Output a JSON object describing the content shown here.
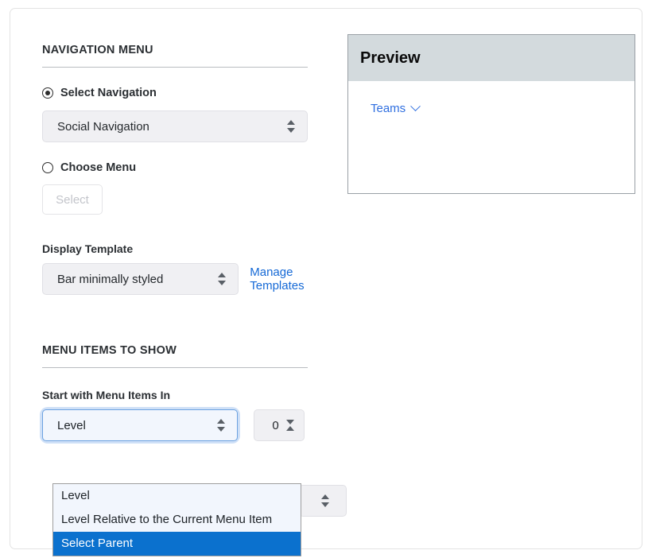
{
  "card": {
    "sections": {
      "navigation": {
        "heading": "NAVIGATION MENU",
        "radio_select_navigation": {
          "label": "Select Navigation",
          "checked": true
        },
        "navigation_select": {
          "value": "Social Navigation"
        },
        "radio_choose_menu": {
          "label": "Choose Menu",
          "checked": false
        },
        "select_button": {
          "label": "Select",
          "disabled": true
        },
        "display_template": {
          "label": "Display Template",
          "value": "Bar minimally styled"
        },
        "manage_templates_link": "Manage Templates"
      },
      "menu_items": {
        "heading": "MENU ITEMS TO SHOW",
        "start_with_label": "Start with Menu Items In",
        "start_with_select": {
          "value": "Level",
          "expanded": true,
          "options": [
            {
              "label": "Level",
              "selected": false
            },
            {
              "label": "Level Relative to the Current Menu Item",
              "selected": false
            },
            {
              "label": "Select Parent",
              "selected": true
            }
          ]
        },
        "level_stepper": {
          "value": "0"
        }
      }
    }
  },
  "preview": {
    "title": "Preview",
    "menu_item": "Teams"
  },
  "colors": {
    "accent_link": "#1569d6",
    "preview_link": "#2f6fe0",
    "selection_blue": "#0b71ce",
    "focus_ring": "#cfe0f7",
    "preview_header": "#d3dadd",
    "control_bg": "#f0f0f3"
  }
}
